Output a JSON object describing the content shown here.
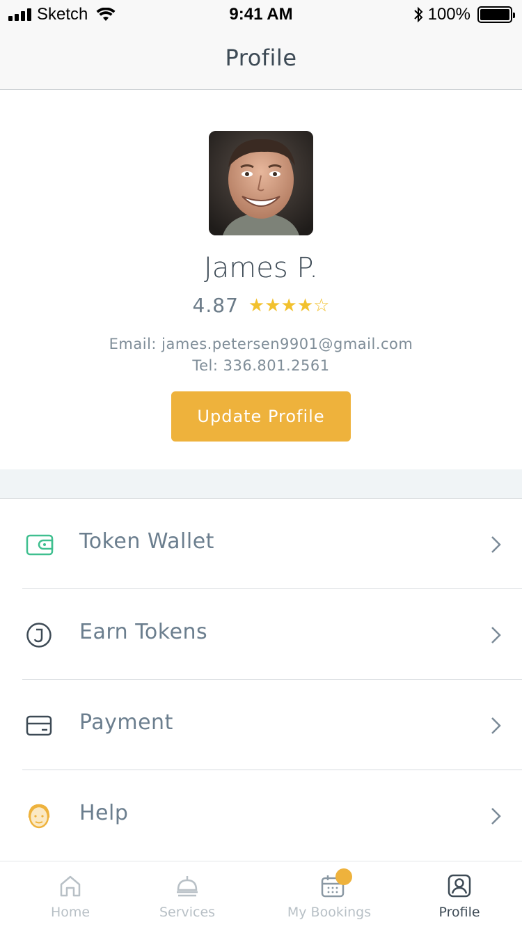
{
  "status_bar": {
    "carrier": "Sketch",
    "time": "9:41 AM",
    "battery": "100%"
  },
  "nav": {
    "title": "Profile"
  },
  "profile": {
    "name": "James P.",
    "rating": "4.87",
    "stars": "★★★★☆",
    "email": "Email: james.petersen9901@gmail.com",
    "tel": "Tel: 336.801.2561",
    "update_button": "Update Profile"
  },
  "menu": {
    "items": [
      {
        "label": "Token Wallet",
        "icon": "wallet-icon"
      },
      {
        "label": "Earn Tokens",
        "icon": "token-coin-icon"
      },
      {
        "label": "Payment",
        "icon": "credit-card-icon"
      },
      {
        "label": "Help",
        "icon": "help-agent-icon"
      }
    ]
  },
  "tabs": [
    {
      "label": "Home",
      "icon": "home-icon"
    },
    {
      "label": "Services",
      "icon": "service-bell-icon"
    },
    {
      "label": "My Bookings",
      "icon": "calendar-icon"
    },
    {
      "label": "Profile",
      "icon": "profile-icon",
      "active": true
    }
  ],
  "colors": {
    "accent": "#eeb23c",
    "wallet_icon": "#3fbf8f",
    "star": "#f2c12e",
    "text_dark": "#3d4a55",
    "text_menu": "#6b7e8e"
  }
}
